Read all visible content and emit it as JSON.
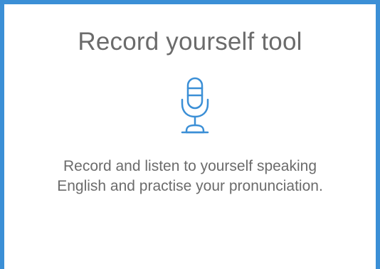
{
  "card": {
    "title": "Record yourself tool",
    "icon": "microphone-icon",
    "description_line_1": "Record and listen to yourself speaking",
    "description_line_2": "English and practise your pronunciation."
  },
  "colors": {
    "accent": "#3b8fd6",
    "text": "#6b6b6b",
    "background": "#ffffff"
  }
}
